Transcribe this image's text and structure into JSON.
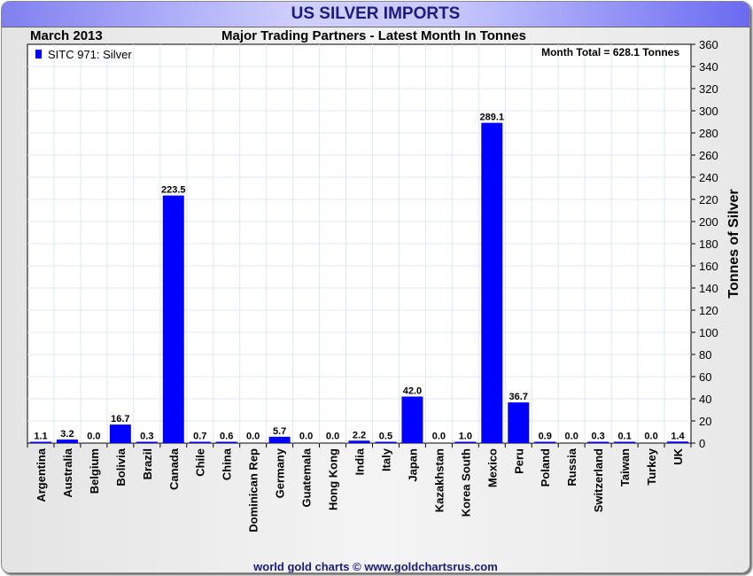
{
  "title": "US SILVER IMPORTS",
  "period": "March 2013",
  "subtitle": "Major Trading Partners - Latest Month In Tonnes",
  "footer": "world gold charts © www.goldchartsrus.com",
  "colors": {
    "bar": "#0000ff",
    "title_text": "#1a1a80"
  },
  "chart_data": {
    "type": "bar",
    "title": "Major Trading Partners - Latest Month In Tonnes",
    "ylabel": "Tonnes of Silver",
    "ylim": [
      0,
      360
    ],
    "ytick_step": 20,
    "yaxis_side": "right",
    "grid": true,
    "legend": {
      "label": "SITC 971: Silver",
      "placement": "top-left"
    },
    "annotation": "Month Total = 628.1 Tonnes",
    "categories": [
      "Argentina",
      "Australia",
      "Belgium",
      "Bolivia",
      "Brazil",
      "Canada",
      "Chile",
      "China",
      "Dominican Rep",
      "Germany",
      "Guatemala",
      "Hong Kong",
      "India",
      "Italy",
      "Japan",
      "Kazakhstan",
      "Korea South",
      "Mexico",
      "Peru",
      "Poland",
      "Russia",
      "Switzerland",
      "Taiwan",
      "Turkey",
      "UK"
    ],
    "values": [
      1.1,
      3.2,
      0.0,
      16.7,
      0.3,
      223.5,
      0.7,
      0.6,
      0.0,
      5.7,
      0.0,
      0.0,
      2.2,
      0.5,
      42.0,
      0.0,
      1.0,
      289.1,
      36.7,
      0.9,
      0.0,
      0.3,
      0.1,
      0.0,
      1.4
    ]
  }
}
